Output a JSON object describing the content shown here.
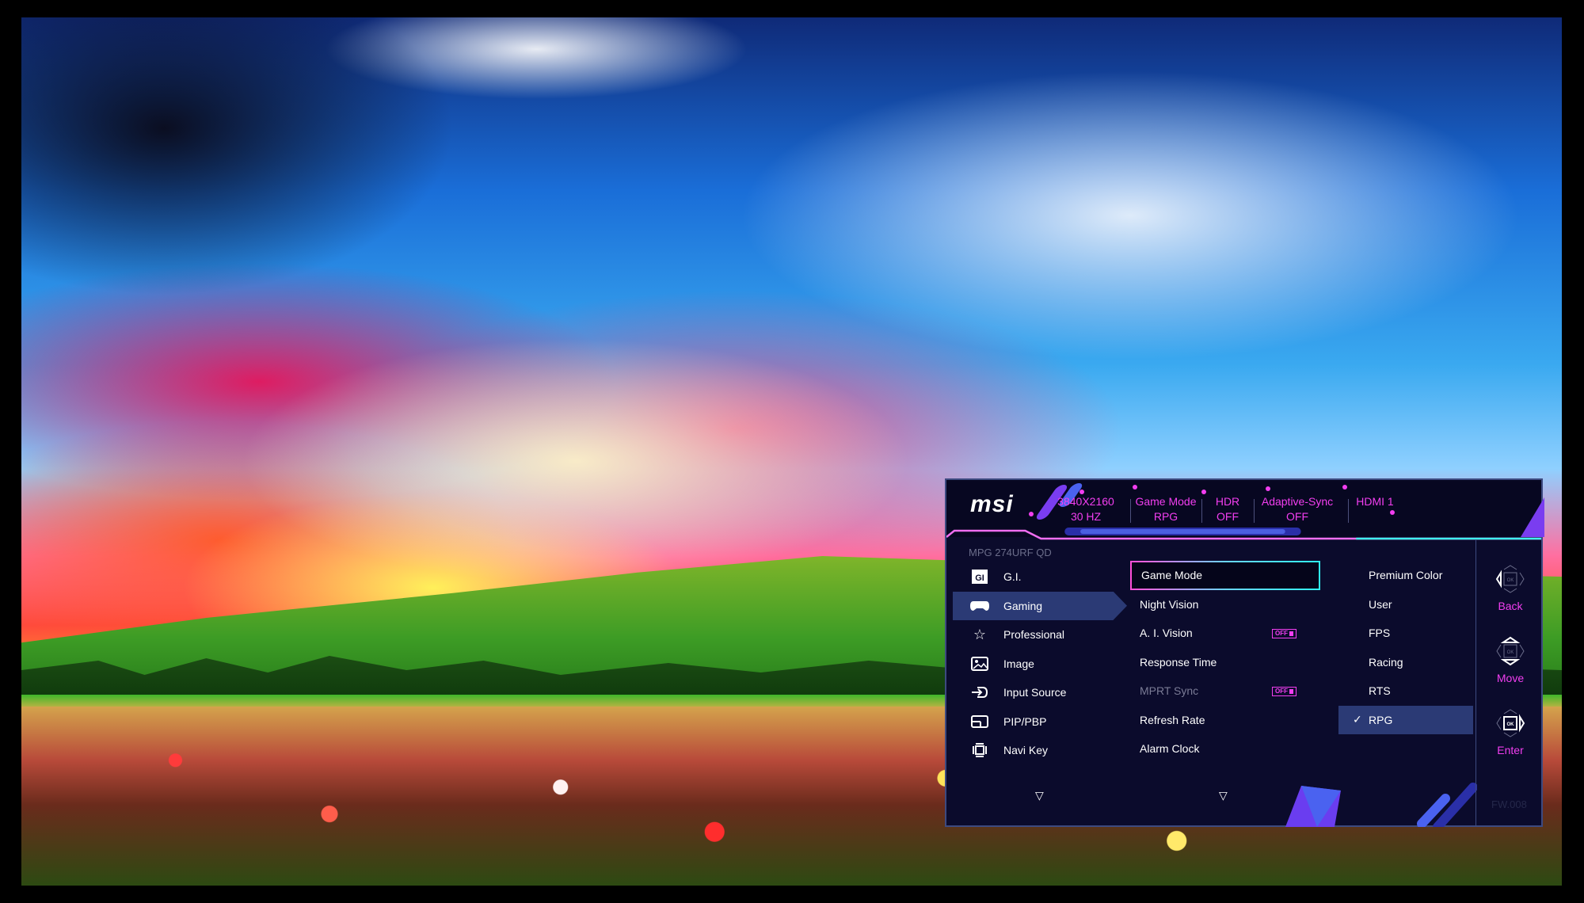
{
  "osd": {
    "brand": "msi",
    "model": "MPG 274URF QD",
    "status_bar": [
      {
        "name": "resolution",
        "line1": "3840X2160",
        "line2": "30 HZ"
      },
      {
        "name": "game-mode",
        "line1": "Game Mode",
        "line2": "RPG"
      },
      {
        "name": "hdr",
        "line1": "HDR",
        "line2": "OFF"
      },
      {
        "name": "adaptive-sync",
        "line1": "Adaptive-Sync",
        "line2": "OFF"
      },
      {
        "name": "input",
        "line1": "HDMI 1",
        "line2": ""
      }
    ],
    "main_menu": [
      {
        "label": "G.I.",
        "icon": "gi-icon",
        "active": false
      },
      {
        "label": "Gaming",
        "icon": "gamepad-icon",
        "active": true
      },
      {
        "label": "Professional",
        "icon": "star-icon",
        "active": false
      },
      {
        "label": "Image",
        "icon": "image-icon",
        "active": false
      },
      {
        "label": "Input Source",
        "icon": "input-source-icon",
        "active": false
      },
      {
        "label": "PIP/PBP",
        "icon": "pip-icon",
        "active": false
      },
      {
        "label": "Navi Key",
        "icon": "navi-key-icon",
        "active": false
      }
    ],
    "gaming_options": [
      {
        "label": "Game Mode",
        "focused": true
      },
      {
        "label": "Night Vision"
      },
      {
        "label": "A. I. Vision",
        "toggle": "OFF"
      },
      {
        "label": "Response Time"
      },
      {
        "label": "MPRT Sync",
        "toggle": "OFF",
        "disabled": true
      },
      {
        "label": "Refresh Rate"
      },
      {
        "label": "Alarm Clock"
      }
    ],
    "game_mode_options": [
      {
        "label": "Premium Color"
      },
      {
        "label": "User"
      },
      {
        "label": "FPS"
      },
      {
        "label": "Racing"
      },
      {
        "label": "RTS"
      },
      {
        "label": "RPG",
        "selected": true
      }
    ],
    "selected_check": "✓",
    "hints": [
      {
        "label": "Back",
        "key": "OK"
      },
      {
        "label": "Move",
        "key": "OK"
      },
      {
        "label": "Enter",
        "key": "OK"
      }
    ],
    "firmware": "FW.008",
    "scroll_down_glyph": "▽",
    "colors": {
      "accent": "#f23ef0",
      "panel": "#0b0b2c",
      "highlight": "#2b3a75",
      "cyan": "#2ff0f0"
    }
  }
}
